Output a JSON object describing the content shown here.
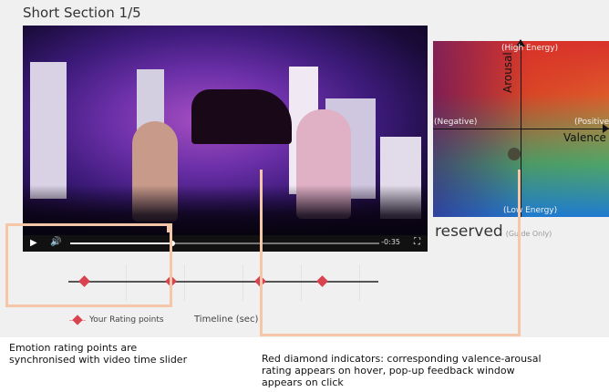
{
  "header": {
    "title": "Short Section 1/5"
  },
  "video": {
    "play_icon": "play-icon",
    "volume_icon": "volume-icon",
    "fullscreen_icon": "fullscreen-icon",
    "time_remaining": "-0:35",
    "progress": 0.33
  },
  "emotion_grid": {
    "top_label": "(High Energy)",
    "bottom_label": "(Low Energy)",
    "left_label": "(Negative)",
    "right_label": "(Positive)",
    "y_axis_name": "Arousal",
    "x_axis_name": "Valence",
    "colors": {
      "red": "#c01a1a",
      "yellow": "#e8b22a",
      "green": "#28aa78",
      "blue": "#1f7ad0"
    }
  },
  "reserved": {
    "text": "reserved",
    "note": "(Guide Only)"
  },
  "timeline": {
    "rating_points": [
      0.05,
      0.33,
      0.62,
      0.82
    ],
    "legend_label": "Your Rating points",
    "axis_label": "Timeline (sec)",
    "diamond_color": "#d94350"
  },
  "annotations": {
    "left": [
      "Emotion rating points are",
      "synchronised with video time slider"
    ],
    "right": [
      "Red diamond indicators: corresponding valence-arousal",
      "rating appears on hover, pop-up feedback window",
      "appears on click"
    ]
  }
}
